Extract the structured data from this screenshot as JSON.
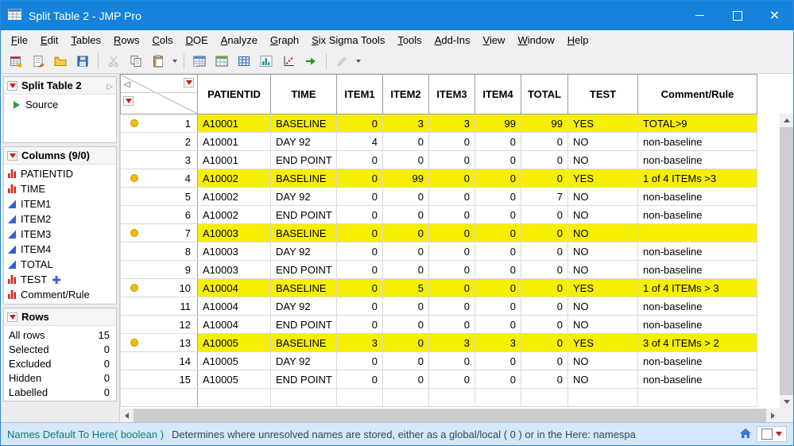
{
  "window": {
    "title": "Split Table 2 - JMP Pro"
  },
  "menu": {
    "items": [
      "File",
      "Edit",
      "Tables",
      "Rows",
      "Cols",
      "DOE",
      "Analyze",
      "Graph",
      "Six Sigma Tools",
      "Tools",
      "Add-Ins",
      "View",
      "Window",
      "Help"
    ]
  },
  "toolbar": {
    "buttons": [
      {
        "icon": "new-data-table"
      },
      {
        "icon": "journal"
      },
      {
        "icon": "open"
      },
      {
        "icon": "save"
      },
      {
        "sep": true
      },
      {
        "icon": "cut",
        "disabled": true
      },
      {
        "icon": "copy"
      },
      {
        "icon": "paste"
      },
      {
        "caret": true
      },
      {
        "sep": true
      },
      {
        "icon": "data-table"
      },
      {
        "icon": "summary"
      },
      {
        "icon": "grid"
      },
      {
        "icon": "distribution"
      },
      {
        "icon": "fit-y-x"
      },
      {
        "icon": "run-script"
      },
      {
        "sep": true
      },
      {
        "icon": "annotate",
        "disabled": true
      },
      {
        "caret": true
      }
    ]
  },
  "sidebar": {
    "table_panel": {
      "title": "Split Table 2",
      "source_label": "Source"
    },
    "columns_panel": {
      "title": "Columns (9/0)",
      "items": [
        {
          "label": "PATIENTID",
          "type": "nominal"
        },
        {
          "label": "TIME",
          "type": "nominal"
        },
        {
          "label": "ITEM1",
          "type": "continuous"
        },
        {
          "label": "ITEM2",
          "type": "continuous"
        },
        {
          "label": "ITEM3",
          "type": "continuous"
        },
        {
          "label": "ITEM4",
          "type": "continuous"
        },
        {
          "label": "TOTAL",
          "type": "continuous"
        },
        {
          "label": "TEST",
          "type": "nominal",
          "formula": true
        },
        {
          "label": "Comment/Rule",
          "type": "nominal"
        }
      ]
    },
    "rows_panel": {
      "title": "Rows",
      "stats": [
        {
          "label": "All rows",
          "value": "15"
        },
        {
          "label": "Selected",
          "value": "0"
        },
        {
          "label": "Excluded",
          "value": "0"
        },
        {
          "label": "Hidden",
          "value": "0"
        },
        {
          "label": "Labelled",
          "value": "0"
        }
      ]
    }
  },
  "table": {
    "columns": [
      {
        "key": "patientid",
        "label": "PATIENTID",
        "align": "left"
      },
      {
        "key": "time",
        "label": "TIME",
        "align": "left"
      },
      {
        "key": "item1",
        "label": "ITEM1",
        "align": "right"
      },
      {
        "key": "item2",
        "label": "ITEM2",
        "align": "right"
      },
      {
        "key": "item3",
        "label": "ITEM3",
        "align": "right"
      },
      {
        "key": "item4",
        "label": "ITEM4",
        "align": "right"
      },
      {
        "key": "total",
        "label": "TOTAL",
        "align": "right"
      },
      {
        "key": "test",
        "label": "TEST",
        "align": "left"
      },
      {
        "key": "comment",
        "label": "Comment/Rule",
        "align": "left"
      }
    ],
    "rows": [
      {
        "n": "1",
        "marker": true,
        "highlight": true,
        "values": [
          "A10001",
          "BASELINE",
          "0",
          "3",
          "3",
          "99",
          "99",
          "YES",
          "TOTAL>9"
        ]
      },
      {
        "n": "2",
        "marker": false,
        "highlight": false,
        "values": [
          "A10001",
          "DAY 92",
          "4",
          "0",
          "0",
          "0",
          "0",
          "NO",
          "non-baseline"
        ]
      },
      {
        "n": "3",
        "marker": false,
        "highlight": false,
        "values": [
          "A10001",
          "END POINT",
          "0",
          "0",
          "0",
          "0",
          "0",
          "NO",
          "non-baseline"
        ]
      },
      {
        "n": "4",
        "marker": true,
        "highlight": true,
        "values": [
          "A10002",
          "BASELINE",
          "0",
          "99",
          "0",
          "0",
          "0",
          "YES",
          "1 of 4 ITEMs >3"
        ]
      },
      {
        "n": "5",
        "marker": false,
        "highlight": false,
        "values": [
          "A10002",
          "DAY 92",
          "0",
          "0",
          "0",
          "0",
          "7",
          "NO",
          "non-baseline"
        ]
      },
      {
        "n": "6",
        "marker": false,
        "highlight": false,
        "values": [
          "A10002",
          "END POINT",
          "0",
          "0",
          "0",
          "0",
          "0",
          "NO",
          "non-baseline"
        ]
      },
      {
        "n": "7",
        "marker": true,
        "highlight": true,
        "values": [
          "A10003",
          "BASELINE",
          "0",
          "0",
          "0",
          "0",
          "0",
          "NO",
          ""
        ]
      },
      {
        "n": "8",
        "marker": false,
        "highlight": false,
        "values": [
          "A10003",
          "DAY 92",
          "0",
          "0",
          "0",
          "0",
          "0",
          "NO",
          "non-baseline"
        ]
      },
      {
        "n": "9",
        "marker": false,
        "highlight": false,
        "values": [
          "A10003",
          "END POINT",
          "0",
          "0",
          "0",
          "0",
          "0",
          "NO",
          "non-baseline"
        ]
      },
      {
        "n": "10",
        "marker": true,
        "highlight": true,
        "values": [
          "A10004",
          "BASELINE",
          "0",
          "5",
          "0",
          "0",
          "0",
          "YES",
          "1 of 4 ITEMs > 3"
        ]
      },
      {
        "n": "11",
        "marker": false,
        "highlight": false,
        "values": [
          "A10004",
          "DAY 92",
          "0",
          "0",
          "0",
          "0",
          "0",
          "NO",
          "non-baseline"
        ]
      },
      {
        "n": "12",
        "marker": false,
        "highlight": false,
        "values": [
          "A10004",
          "END POINT",
          "0",
          "0",
          "0",
          "0",
          "0",
          "NO",
          "non-baseline"
        ]
      },
      {
        "n": "13",
        "marker": true,
        "highlight": true,
        "values": [
          "A10005",
          "BASELINE",
          "3",
          "0",
          "3",
          "3",
          "0",
          "YES",
          "3 of 4 ITEMs > 2"
        ]
      },
      {
        "n": "14",
        "marker": false,
        "highlight": false,
        "values": [
          "A10005",
          "DAY 92",
          "0",
          "0",
          "0",
          "0",
          "0",
          "NO",
          "non-baseline"
        ]
      },
      {
        "n": "15",
        "marker": false,
        "highlight": false,
        "values": [
          "A10005",
          "END POINT",
          "0",
          "0",
          "0",
          "0",
          "0",
          "NO",
          "non-baseline"
        ]
      }
    ]
  },
  "status_bar": {
    "primary": "Names Default To Here( boolean )",
    "secondary": "Determines where unresolved names are stored, either as a global/local ( 0 ) or in the Here: namespa"
  },
  "colors": {
    "titlebar": "#1583dc",
    "highlight": "#f7ef00",
    "marker": "#eebf00",
    "accent_red": "#c41e1e"
  }
}
